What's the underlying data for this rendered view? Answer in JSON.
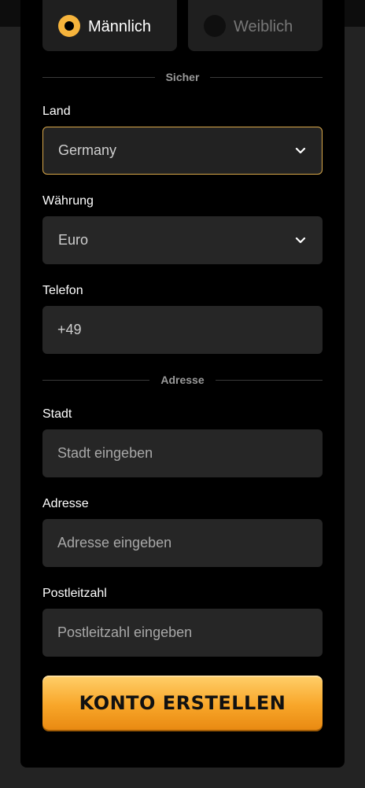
{
  "gender": {
    "male_label": "Männlich",
    "female_label": "Weiblich",
    "selected": "male"
  },
  "sections": {
    "secure": "Sicher",
    "address": "Adresse"
  },
  "country": {
    "label": "Land",
    "value": "Germany"
  },
  "currency": {
    "label": "Währung",
    "value": "Euro"
  },
  "phone": {
    "label": "Telefon",
    "value": "+49"
  },
  "city": {
    "label": "Stadt",
    "placeholder": "Stadt eingeben"
  },
  "address": {
    "label": "Adresse",
    "placeholder": "Adresse eingeben"
  },
  "postal": {
    "label": "Postleitzahl",
    "placeholder": "Postleitzahl eingeben"
  },
  "submit": {
    "label": "KONTO ERSTELLEN"
  },
  "colors": {
    "accent": "#f6b43c",
    "panel": "#000000",
    "field": "#262626"
  }
}
